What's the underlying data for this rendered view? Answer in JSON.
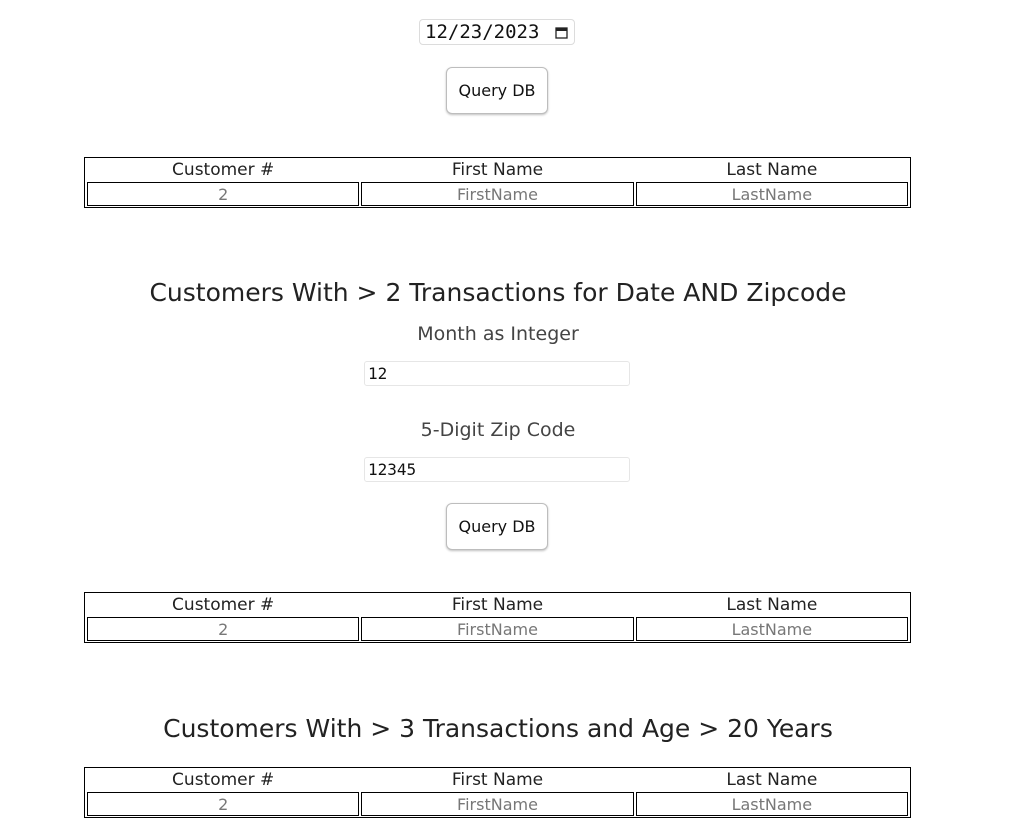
{
  "date_query": {
    "date_value": "12/23/2023",
    "button_label": "Query DB",
    "table": {
      "headers": [
        "Customer #",
        "First Name",
        "Last Name"
      ],
      "rows": [
        [
          "2",
          "FirstName",
          "LastName"
        ]
      ]
    }
  },
  "zip_query": {
    "title": "Customers With > 2 Transactions for Date AND Zipcode",
    "month_label": "Month as Integer",
    "month_value": "12",
    "zip_label": "5-Digit Zip Code",
    "zip_value": "12345",
    "button_label": "Query DB",
    "table": {
      "headers": [
        "Customer #",
        "First Name",
        "Last Name"
      ],
      "rows": [
        [
          "2",
          "FirstName",
          "LastName"
        ]
      ]
    }
  },
  "age_query": {
    "title": "Customers With > 3 Transactions and Age > 20 Years",
    "table": {
      "headers": [
        "Customer #",
        "First Name",
        "Last Name"
      ],
      "rows": [
        [
          "2",
          "FirstName",
          "LastName"
        ]
      ]
    }
  },
  "icons": {
    "date_picker": "calendar-icon"
  }
}
